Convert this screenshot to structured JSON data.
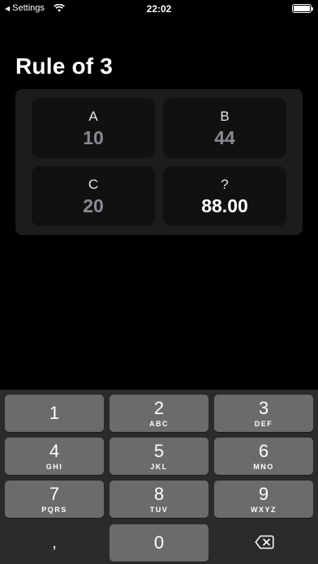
{
  "status_bar": {
    "back_label": "Settings",
    "time": "22:02"
  },
  "title": "Rule of 3",
  "cells": {
    "a": {
      "label": "A",
      "value": "10"
    },
    "b": {
      "label": "B",
      "value": "44"
    },
    "c": {
      "label": "C",
      "value": "20"
    },
    "result": {
      "label": "?",
      "value": "88.00"
    }
  },
  "keypad": {
    "keys": [
      {
        "digit": "1",
        "letters": ""
      },
      {
        "digit": "2",
        "letters": "ABC"
      },
      {
        "digit": "3",
        "letters": "DEF"
      },
      {
        "digit": "4",
        "letters": "GHI"
      },
      {
        "digit": "5",
        "letters": "JKL"
      },
      {
        "digit": "6",
        "letters": "MNO"
      },
      {
        "digit": "7",
        "letters": "PQRS"
      },
      {
        "digit": "8",
        "letters": "TUV"
      },
      {
        "digit": "9",
        "letters": "WXYZ"
      },
      {
        "digit": ",",
        "letters": ""
      },
      {
        "digit": "0",
        "letters": ""
      }
    ],
    "delete_icon": "delete-backspace-icon"
  }
}
